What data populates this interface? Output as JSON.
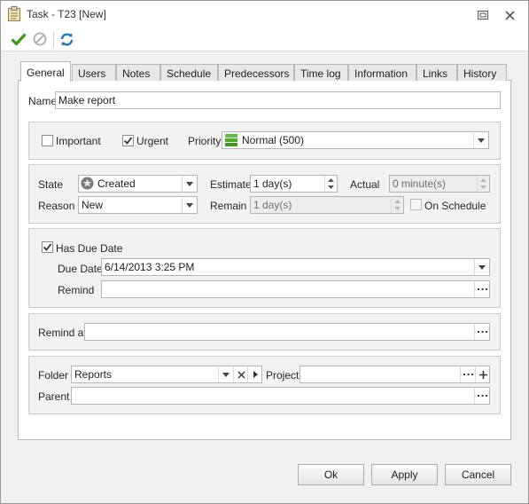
{
  "window": {
    "title": "Task - T23 [New]"
  },
  "icons": {
    "title": "clipboard-icon",
    "save": "checkmark-icon",
    "cancel": "cancel-circle-icon",
    "refresh": "refresh-icon",
    "restore": "restore-window-icon",
    "close": "close-icon"
  },
  "tabs": [
    {
      "label": "General"
    },
    {
      "label": "Users"
    },
    {
      "label": "Notes"
    },
    {
      "label": "Schedule"
    },
    {
      "label": "Predecessors"
    },
    {
      "label": "Time log"
    },
    {
      "label": "Information"
    },
    {
      "label": "Links"
    },
    {
      "label": "History"
    }
  ],
  "general": {
    "name_label": "Name",
    "name_value": "Make report",
    "important_label": "Important",
    "important_checked": false,
    "urgent_label": "Urgent",
    "urgent_checked": true,
    "priority_label": "Priority",
    "priority_value": "Normal (500)",
    "priority_color": "#4caf2a",
    "state_label": "State",
    "state_value": "Created",
    "reason_label": "Reason",
    "reason_value": "New",
    "estimate_label": "Estimate",
    "estimate_value": "1 day(s)",
    "remain_label": "Remain",
    "remain_value": "1 day(s)",
    "actual_label": "Actual",
    "actual_value": "0 minute(s)",
    "on_schedule_label": "On Schedule",
    "on_schedule_checked": false,
    "has_due_date_label": "Has Due Date",
    "has_due_date_checked": true,
    "due_date_label": "Due Date",
    "due_date_value": "6/14/2013 3:25 PM",
    "remind_label": "Remind",
    "remind_value": "",
    "remind_at_label": "Remind at",
    "remind_at_value": "",
    "folder_label": "Folder",
    "folder_value": "Reports",
    "project_label": "Project",
    "project_value": "",
    "parent_label": "Parent",
    "parent_value": ""
  },
  "buttons": {
    "ok": "Ok",
    "apply": "Apply",
    "cancel": "Cancel"
  },
  "colors": {
    "check_green": "#3c9a16",
    "refresh_blue": "#1a73c9",
    "tab_border": "#b9b9b9"
  }
}
